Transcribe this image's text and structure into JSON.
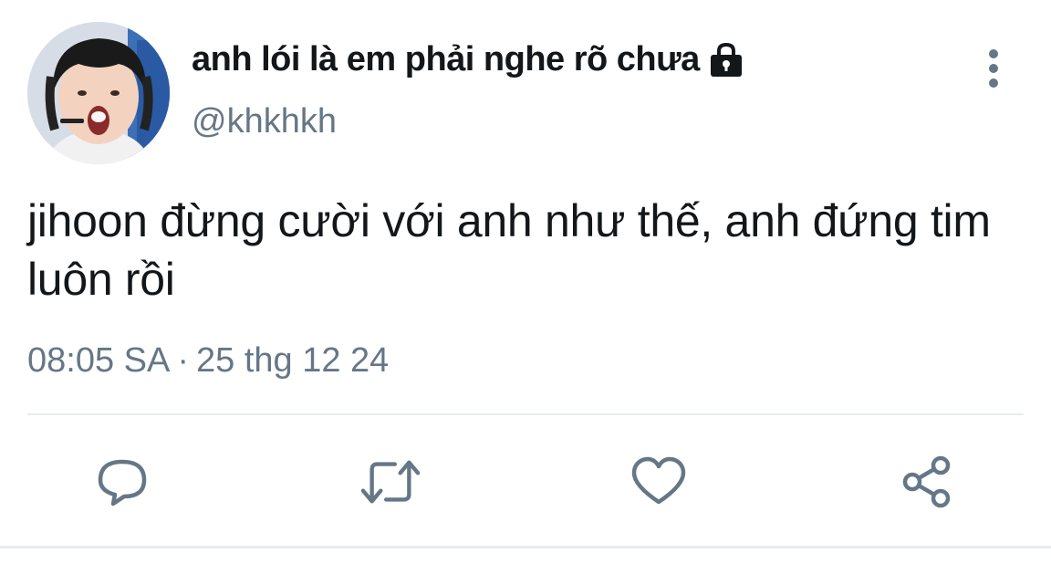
{
  "tweet": {
    "display_name": "anh lói là em phải nghe rõ chưa",
    "handle": "@khkhkh",
    "text": "jihoon đừng cười với anh như thế, anh đứng tim luôn rồi",
    "time": "08:05 SA",
    "separator": "·",
    "date": "25 thg 12 24",
    "protected_icon": "lock-icon",
    "more_icon": "more-vertical-icon"
  },
  "actions": [
    {
      "name": "reply",
      "icon": "comment-icon"
    },
    {
      "name": "retweet",
      "icon": "retweet-icon"
    },
    {
      "name": "like",
      "icon": "heart-icon"
    },
    {
      "name": "share",
      "icon": "share-icon"
    }
  ],
  "colors": {
    "text_primary": "#14171a",
    "text_secondary": "#657786",
    "divider": "#e6ecf0",
    "icon": "#657786"
  }
}
